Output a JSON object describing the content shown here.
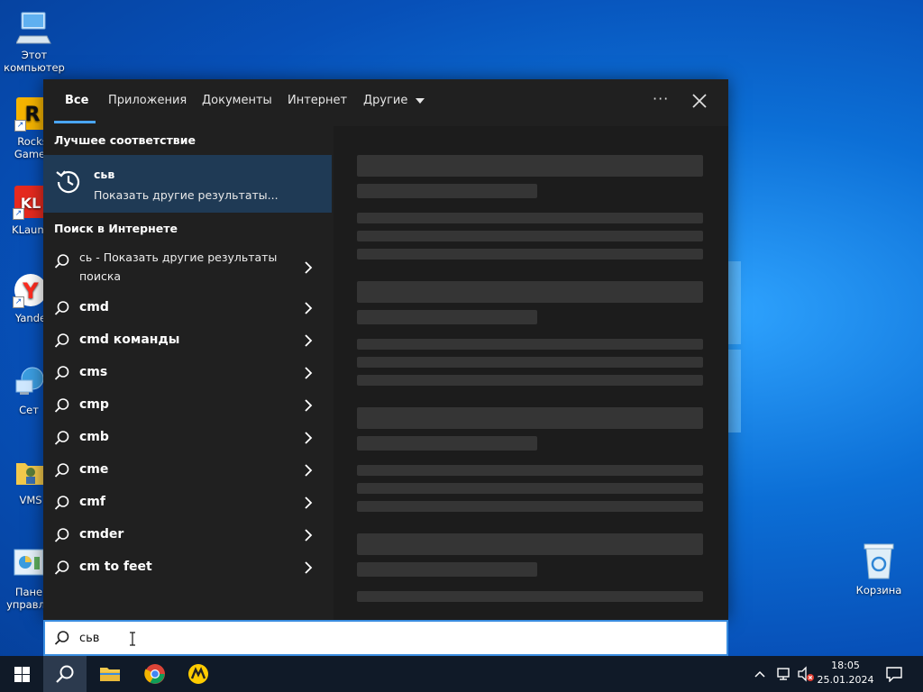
{
  "desktop": {
    "icons": [
      {
        "label": "Этот\nкомпьютер",
        "icon": "computer-icon"
      },
      {
        "label": "Rocks\nGames",
        "icon": "rockstar-games-icon"
      },
      {
        "label": "KLaunc",
        "icon": "klauncher-icon"
      },
      {
        "label": "Yande",
        "icon": "yandex-browser-icon"
      },
      {
        "label": "Сет",
        "icon": "network-icon"
      },
      {
        "label": "VMS",
        "icon": "vms-folder-icon"
      },
      {
        "label": "Пане\nуправле",
        "icon": "control-panel-icon"
      }
    ],
    "recycle_bin": "Корзина"
  },
  "search_panel": {
    "tabs": [
      {
        "label": "Все",
        "active": true
      },
      {
        "label": "Приложения"
      },
      {
        "label": "Документы"
      },
      {
        "label": "Интернет"
      },
      {
        "label": "Другие"
      }
    ],
    "more_label": "···",
    "best_match": {
      "section_title": "Лучшее соответствие",
      "title": "сьв",
      "subtitle": "Показать другие результаты..."
    },
    "web_search": {
      "section_title": "Поиск в Интернете",
      "items": [
        "сь - Показать другие результаты поиска",
        "cmd",
        "cmd команды",
        "cms",
        "cmp",
        "cmb",
        "cme",
        "cmf",
        "cmder",
        "cm to feet"
      ]
    },
    "search_value": "сьв"
  },
  "taskbar": {
    "time": "18:05",
    "date": "25.01.2024"
  },
  "colors": {
    "accent": "#4aa6ff",
    "panel_bg": "#202020",
    "best_match_bg": "#1f3a55",
    "taskbar_bg": "#101a28"
  }
}
